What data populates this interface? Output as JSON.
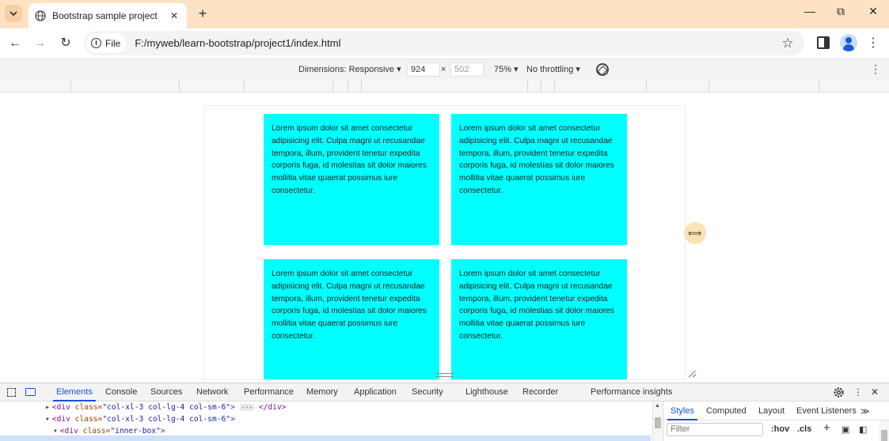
{
  "browser": {
    "tab_title": "Bootstrap sample project",
    "new_tab_icon": "+",
    "close_tab_icon": "✕",
    "window_controls": {
      "minimize": "—",
      "restore": "⧉",
      "close": "✕"
    }
  },
  "address_bar": {
    "chip_label": "File",
    "url": "F:/myweb/learn-bootstrap/project1/index.html",
    "back_icon": "←",
    "forward_icon": "→",
    "reload_icon": "↻",
    "bookmark_icon": "☆",
    "menu_icon": "⋮"
  },
  "device_toolbar": {
    "dimensions_label": "Dimensions: Responsive",
    "width_value": "924",
    "times_sign": "×",
    "height_placeholder": "502",
    "zoom": "75%",
    "throttling": "No throttling",
    "dropdown_caret": "▾",
    "more_icon": "⋮"
  },
  "page": {
    "boxes": [
      {
        "text": "Lorem ipsum dolor sit amet consectetur adipisicing elit. Culpa magni ut recusandae tempora, illum, provident tenetur expedita corporis fuga, id molestias sit dolor maiores mollitia vitae quaerat possimus iure consectetur."
      },
      {
        "text": "Lorem ipsum dolor sit amet consectetur adipisicing elit. Culpa magni ut recusandae tempora, illum, provident tenetur expedita corporis fuga, id molestias sit dolor maiores mollitia vitae quaerat possimus iure consectetur."
      },
      {
        "text": "Lorem ipsum dolor sit amet consectetur adipisicing elit. Culpa magni ut recusandae tempora, illum, provident tenetur expedita corporis fuga, id molestias sit dolor maiores mollitia vitae quaerat possimus iure consectetur."
      },
      {
        "text": "Lorem ipsum dolor sit amet consectetur adipisicing elit. Culpa magni ut recusandae tempora, illum, provident tenetur expedita corporis fuga, id molestias sit dolor maiores mollitia vitae quaerat possimus iure consectetur."
      }
    ],
    "box_color": "#00ffff"
  },
  "devtools": {
    "tabs": [
      "Elements",
      "Console",
      "Sources",
      "Network",
      "Performance",
      "Memory",
      "Application",
      "Security",
      "Lighthouse",
      "Recorder",
      "Performance insights"
    ],
    "active_tab": "Elements",
    "code_lines": [
      {
        "tag_open": "<div ",
        "attr": "class=",
        "value": "\"col-xl-3 col-lg-4 col-sm-6\"",
        "tail": ">",
        "ellipsis": "···",
        "close": "</div>"
      },
      {
        "tag_open": "<div ",
        "attr": "class=",
        "value": "\"col-xl-3 col-lg-4 col-sm-6\"",
        "tail": ">"
      },
      {
        "tag_open": "<div ",
        "attr": "class=",
        "value": "\"inner-box\"",
        "tail": ">"
      }
    ],
    "styles_tabs": [
      "Styles",
      "Computed",
      "Layout",
      "Event Listeners"
    ],
    "styles_more": "≫",
    "filter_placeholder": "Filter",
    "hov": ":hov",
    "cls": ".cls",
    "add_rule": "+"
  }
}
